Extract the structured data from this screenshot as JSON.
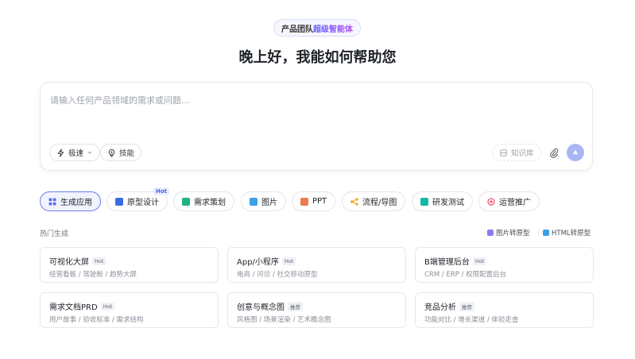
{
  "badge": {
    "prefix": "产品团队",
    "accent": "超级智能体"
  },
  "greeting": "晚上好，我能如何帮助您",
  "input": {
    "placeholder": "请输入任何产品领域的需求或问题...",
    "value": ""
  },
  "toolbar": {
    "speed_label": "极速",
    "skill_label": "技能",
    "knowledge_label": "知识库"
  },
  "categories": [
    {
      "label": "生成应用",
      "icon_color": "#5b6cf0",
      "active": true
    },
    {
      "label": "原型设计",
      "icon_color": "#3b6de0",
      "active": false,
      "tag": "Hot"
    },
    {
      "label": "需求策划",
      "icon_color": "#22b07d",
      "active": false
    },
    {
      "label": "图片",
      "icon_color": "#3aa0e8",
      "active": false
    },
    {
      "label": "PPT",
      "icon_color": "#f07a4a",
      "active": false
    },
    {
      "label": "流程/导图",
      "icon_color": "#f0a020",
      "active": false
    },
    {
      "label": "研发测试",
      "icon_color": "#14b8a6",
      "active": false
    },
    {
      "label": "运营推广",
      "icon_color": "#ef4d6b",
      "active": false
    }
  ],
  "hot_section": {
    "label": "热门生成",
    "convert_image": "图片转原型",
    "convert_html": "HTML转原型"
  },
  "cards": [
    {
      "title": "可视化大屏",
      "tag": "Hot",
      "desc": "经营看板 / 驾驶舱 / 趋势大屏"
    },
    {
      "title": "App/小程序",
      "tag": "Hot",
      "desc": "电商 / 问诊 / 社交移动原型"
    },
    {
      "title": "B端管理后台",
      "tag": "Hot",
      "desc": "CRM / ERP / 权限配置后台"
    },
    {
      "title": "需求文档PRD",
      "tag": "Hot",
      "desc": "用户故事 / 验收标准 / 需求结构"
    },
    {
      "title": "创意与概念图",
      "tag": "推荐",
      "desc": "风格图 / 场景渲染 / 艺术概念图"
    },
    {
      "title": "竞品分析",
      "tag": "推荐",
      "desc": "功能对比 / 增长渠道 / 体验走查"
    }
  ],
  "colors": {
    "accent": "#5b5bf6",
    "send_button": "#a9b6f5",
    "active_border": "#6f7cf0"
  }
}
